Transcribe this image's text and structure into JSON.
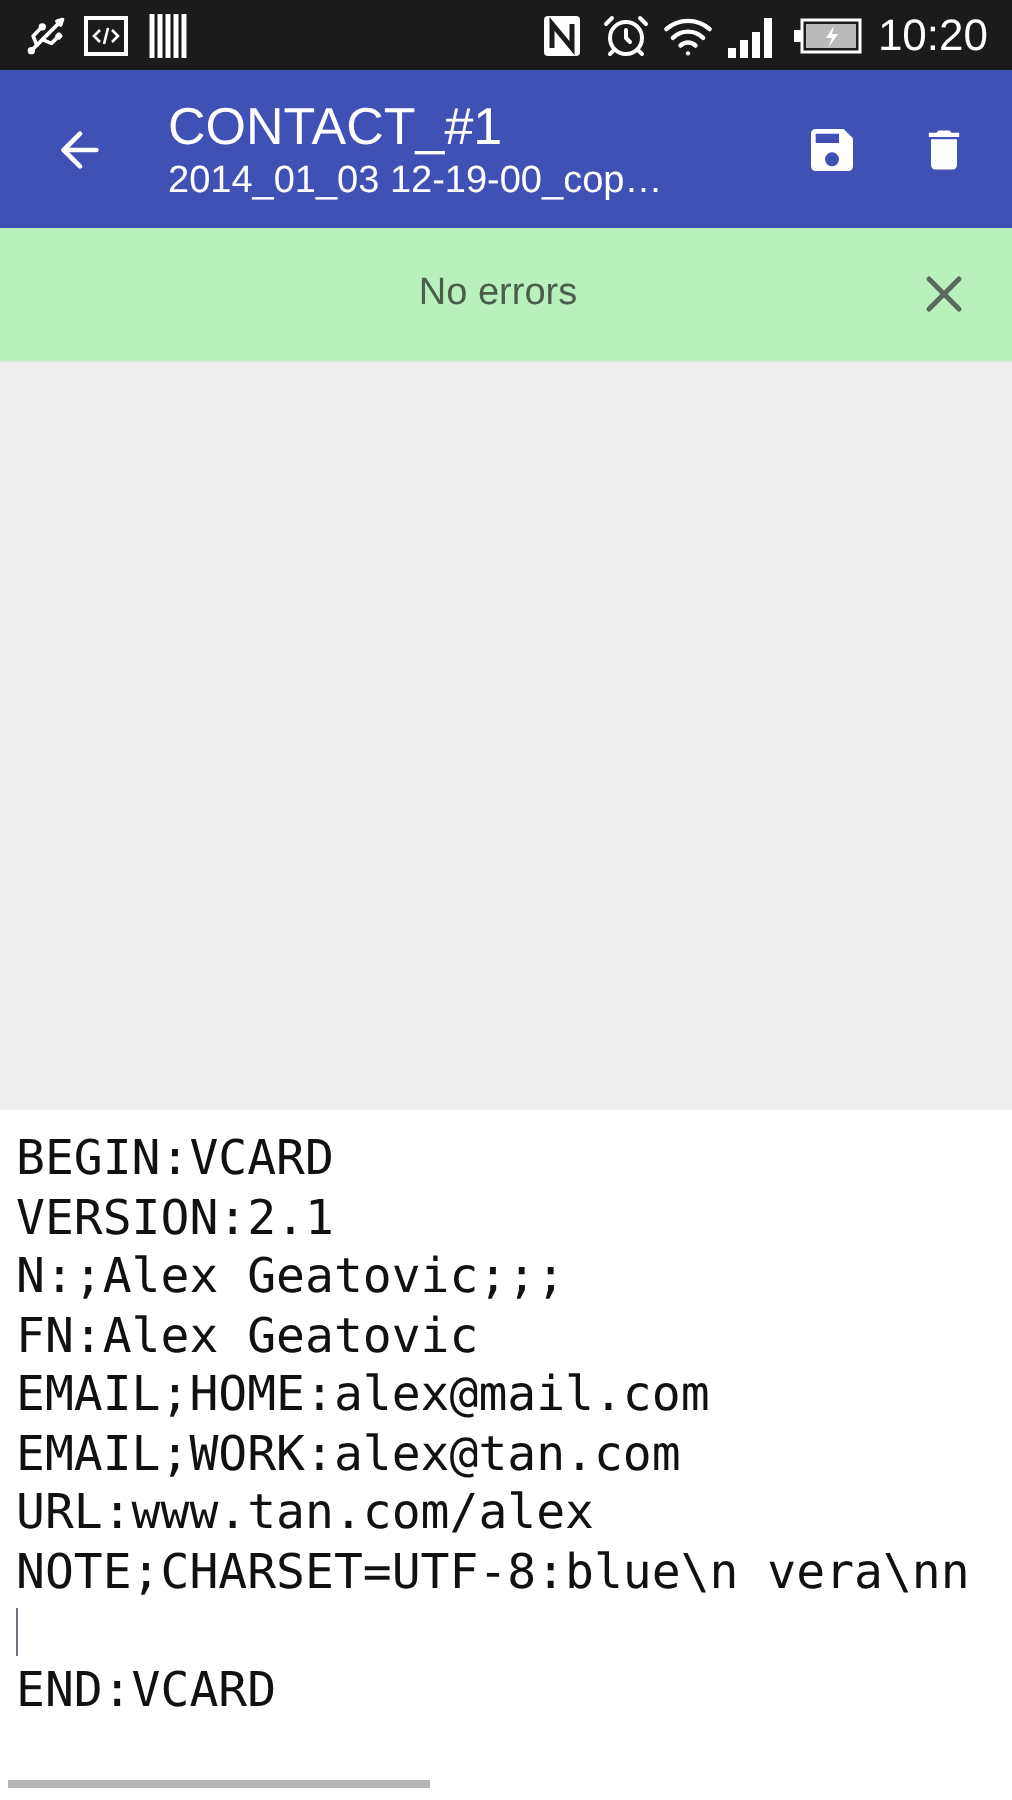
{
  "status_bar": {
    "time": "10:20"
  },
  "toolbar": {
    "title": "CONTACT_#1",
    "subtitle": "2014_01_03 12-19-00_cop…"
  },
  "banner": {
    "message": "No errors"
  },
  "editor": {
    "lines": [
      {
        "kind": "text",
        "text": "BEGIN:VCARD"
      },
      {
        "kind": "text",
        "text": "VERSION:2.1"
      },
      {
        "kind": "text",
        "text": "N:;Alex Geatovic;;;"
      },
      {
        "kind": "text",
        "text": "FN:Alex Geatovic"
      },
      {
        "kind": "text",
        "text": "EMAIL;HOME:alex@mail.com"
      },
      {
        "kind": "text",
        "text": "EMAIL;WORK:alex@tan.com"
      },
      {
        "kind": "text",
        "text": "URL:www.tan.com/alex"
      },
      {
        "kind": "text",
        "text": "NOTE;CHARSET=UTF-8:blue\\n vera\\nn"
      },
      {
        "kind": "cursor"
      },
      {
        "kind": "text",
        "text": "END:VCARD"
      }
    ]
  }
}
